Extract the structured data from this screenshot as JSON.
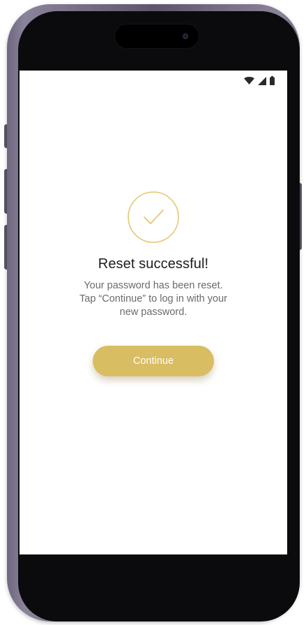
{
  "status_bar": {
    "icons": [
      "wifi-icon",
      "cellular-signal-icon",
      "battery-icon"
    ]
  },
  "reset": {
    "icon": "check-circle-icon",
    "title": "Reset successful!",
    "message_lines": [
      "Your password has been reset.",
      "Tap “Continue” to log in with your",
      "new password."
    ],
    "continue_label": "Continue"
  },
  "colors": {
    "accent": "#d9bd62",
    "text_primary": "#1d1d1f",
    "text_secondary": "#6b6b6b",
    "frame": "#6e6780"
  }
}
